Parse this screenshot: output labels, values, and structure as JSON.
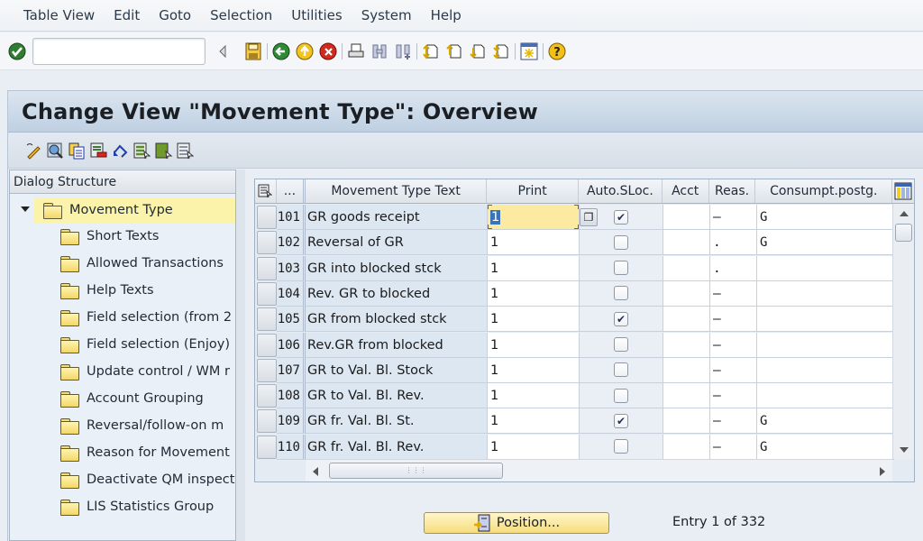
{
  "menu": [
    "Table View",
    "Edit",
    "Goto",
    "Selection",
    "Utilities",
    "System",
    "Help"
  ],
  "command_field": {
    "value": "",
    "placeholder": ""
  },
  "standard_toolbar_icons": [
    "enter-check-icon",
    "command-field",
    "collapse-triangle-icon",
    "save-icon",
    "back-icon",
    "exit-icon",
    "cancel-icon",
    "print-icon",
    "find-icon",
    "find-next-icon",
    "first-page-icon",
    "previous-page-icon",
    "next-page-icon",
    "last-page-icon",
    "new-session-icon",
    "help-icon"
  ],
  "title": "Change View \"Movement Type\": Overview",
  "app_toolbar_icons": [
    "display-change-icon",
    "details-icon",
    "copy-as-icon",
    "delete-icon",
    "undo-change-icon",
    "select-all-icon",
    "select-block-icon",
    "deselect-all-icon"
  ],
  "dialog_structure": {
    "header": "Dialog Structure",
    "root": "Movement Type",
    "children": [
      "Short Texts",
      "Allowed Transactions",
      "Help Texts",
      "Field selection (from 2",
      "Field selection (Enjoy)",
      "Update control / WM r",
      "Account Grouping",
      "Reversal/follow-on m",
      "Reason for Movement",
      "Deactivate QM inspect",
      "LIS Statistics Group"
    ]
  },
  "table": {
    "columns": [
      "...",
      "Movement Type Text",
      "Print",
      "Auto.SLoc.",
      "Acct",
      "Reas.",
      "Consumpt.postg."
    ],
    "rows": [
      {
        "mvt": "101",
        "text": "GR goods receipt",
        "print": "1",
        "auto_sloc": true,
        "acct": "",
        "reas": "–",
        "cons": "G"
      },
      {
        "mvt": "102",
        "text": "Reversal of GR",
        "print": "1",
        "auto_sloc": false,
        "acct": "",
        "reas": ".",
        "cons": "G"
      },
      {
        "mvt": "103",
        "text": "GR into blocked stck",
        "print": "1",
        "auto_sloc": false,
        "acct": "",
        "reas": ".",
        "cons": ""
      },
      {
        "mvt": "104",
        "text": "Rev. GR to blocked",
        "print": "1",
        "auto_sloc": false,
        "acct": "",
        "reas": "–",
        "cons": ""
      },
      {
        "mvt": "105",
        "text": "GR from blocked stck",
        "print": "1",
        "auto_sloc": true,
        "acct": "",
        "reas": "–",
        "cons": ""
      },
      {
        "mvt": "106",
        "text": "Rev.GR from blocked",
        "print": "1",
        "auto_sloc": false,
        "acct": "",
        "reas": "–",
        "cons": ""
      },
      {
        "mvt": "107",
        "text": "GR to Val. Bl. Stock",
        "print": "1",
        "auto_sloc": false,
        "acct": "",
        "reas": "–",
        "cons": ""
      },
      {
        "mvt": "108",
        "text": "GR to Val. Bl. Rev.",
        "print": "1",
        "auto_sloc": false,
        "acct": "",
        "reas": "–",
        "cons": ""
      },
      {
        "mvt": "109",
        "text": "GR fr. Val. Bl. St.",
        "print": "1",
        "auto_sloc": true,
        "acct": "",
        "reas": "–",
        "cons": "G"
      },
      {
        "mvt": "110",
        "text": "GR fr. Val. Bl. Rev.",
        "print": "1",
        "auto_sloc": false,
        "acct": "",
        "reas": "–",
        "cons": "G"
      }
    ]
  },
  "position_button": "Position...",
  "entry_status": "Entry 1 of 332"
}
